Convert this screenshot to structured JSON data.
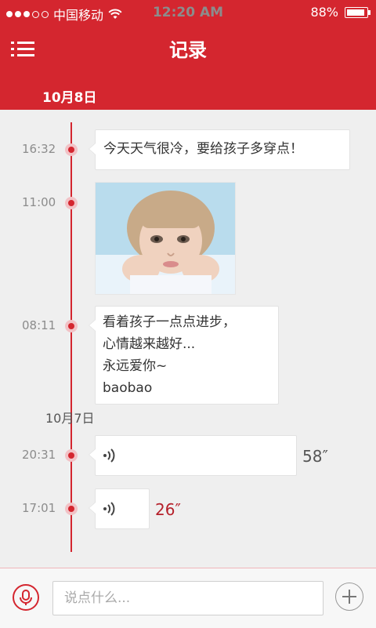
{
  "status_bar": {
    "carrier": "中国移动",
    "time": "12:20 AM",
    "battery": "88%",
    "battery_level": 0.88
  },
  "navbar": {
    "title": "记录",
    "menu_icon": "menu-icon"
  },
  "colors": {
    "brand": "#d4262f",
    "background": "#efefef",
    "time_text": "#8c8c8c",
    "accent_text": "#b5202a"
  },
  "timeline": {
    "date_header": "10月8日",
    "entries": [
      {
        "time": "16:32",
        "type": "text",
        "text": "今天天气很冷，要给孩子多穿点！"
      },
      {
        "time": "11:00",
        "type": "image",
        "image_alt": "child photo"
      },
      {
        "time": "08:11",
        "type": "text",
        "text": "看着孩子一点点进步，\n心情越来越好...\n永远爱你~\nbaobao"
      }
    ],
    "second_date": "10月7日",
    "entries_second": [
      {
        "time": "20:31",
        "type": "voice",
        "duration": "58″",
        "icon": "voice-icon"
      },
      {
        "time": "17:01",
        "type": "voice",
        "duration": "26″",
        "icon": "voice-icon"
      }
    ]
  },
  "input_bar": {
    "placeholder": "说点什么...",
    "value": "",
    "mic_icon": "microphone-icon",
    "add_icon": "plus-icon"
  }
}
